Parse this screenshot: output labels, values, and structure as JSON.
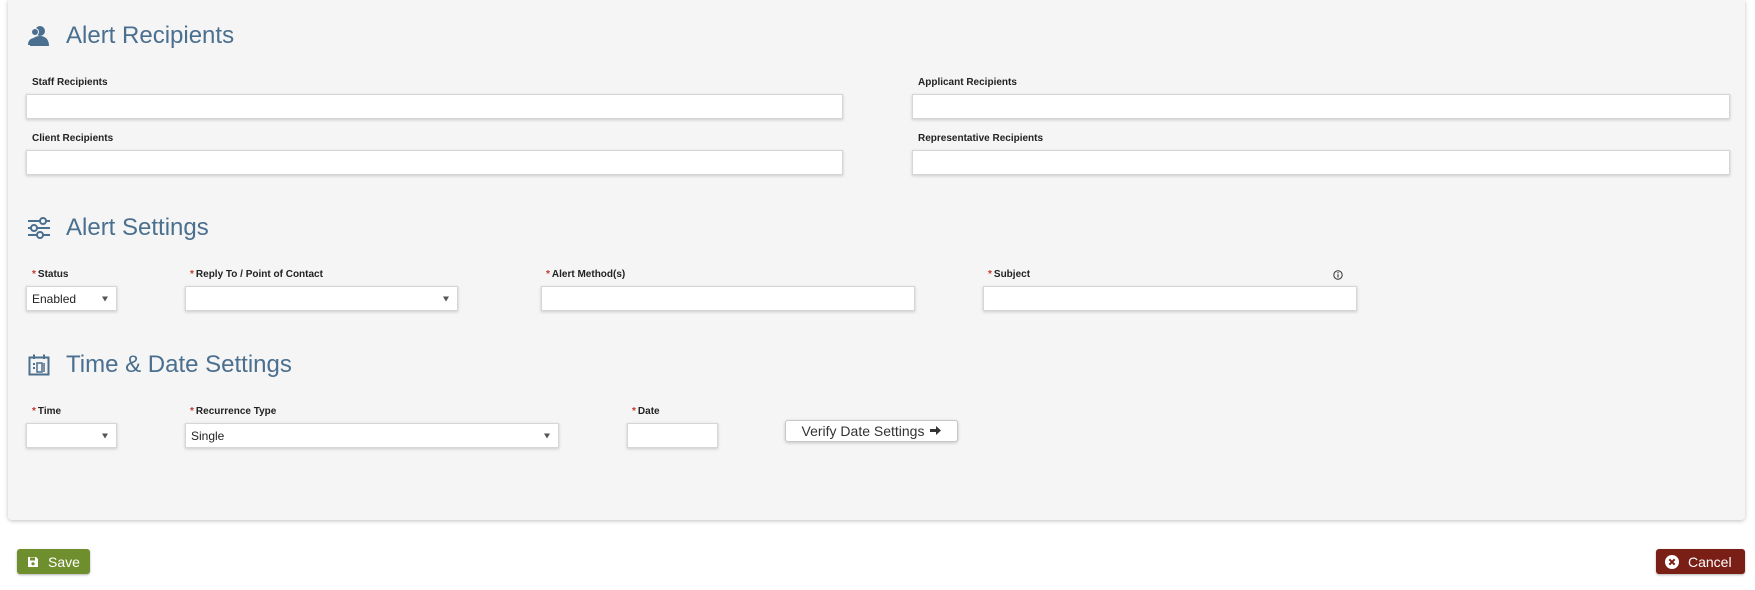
{
  "recipients": {
    "title": "Alert Recipients",
    "staff_label": "Staff Recipients",
    "staff_value": "",
    "applicant_label": "Applicant Recipients",
    "applicant_value": "",
    "client_label": "Client Recipients",
    "client_value": "",
    "representative_label": "Representative Recipients",
    "representative_value": ""
  },
  "settings": {
    "title": "Alert Settings",
    "required_marker": "*",
    "status_label": "Status",
    "status_value": "Enabled",
    "reply_to_label": "Reply To / Point of Contact",
    "reply_to_value": "",
    "alert_methods_label": "Alert Method(s)",
    "alert_methods_value": "",
    "subject_label": "Subject",
    "subject_value": ""
  },
  "datetime": {
    "title": "Time & Date Settings",
    "time_label": "Time",
    "time_value": "",
    "recurrence_label": "Recurrence Type",
    "recurrence_value": "Single",
    "date_label": "Date",
    "date_value": "",
    "verify_button": "Verify Date Settings"
  },
  "footer": {
    "save_label": "Save",
    "cancel_label": "Cancel"
  },
  "colors": {
    "heading": "#4a6f8f",
    "required": "#c0392b",
    "save": "#6f8f2e",
    "cancel": "#7a1f16"
  },
  "icons": {
    "recipients": "users-icon",
    "settings": "sliders-icon",
    "datetime": "calendar-icon",
    "info": "info-icon",
    "verify_arrow": "arrow-right-icon",
    "save": "floppy-disk-icon",
    "cancel": "close-circle-icon"
  }
}
